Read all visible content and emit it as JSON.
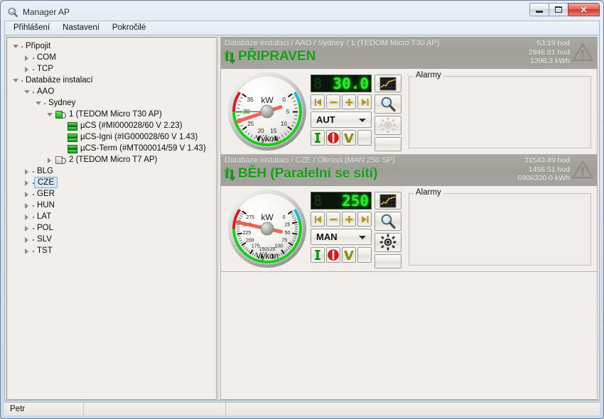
{
  "window": {
    "title": "Manager AP",
    "icon": "app-icon",
    "buttons": {
      "minimize": "minimize",
      "maximize": "restore",
      "close": "✕"
    }
  },
  "menu": {
    "items": [
      {
        "label": "Přihlášení"
      },
      {
        "label": "Nastavení"
      },
      {
        "label": "Pokročilé"
      }
    ]
  },
  "tree": {
    "nodes": [
      {
        "label": "Připojit",
        "depth": 0,
        "state": "open",
        "icon": "none"
      },
      {
        "label": "COM",
        "depth": 1,
        "state": "closed",
        "icon": "none"
      },
      {
        "label": "TCP",
        "depth": 1,
        "state": "closed",
        "icon": "none"
      },
      {
        "label": "Databáze instalací",
        "depth": 0,
        "state": "open",
        "icon": "none"
      },
      {
        "label": "AAO",
        "depth": 1,
        "state": "open",
        "icon": "none"
      },
      {
        "label": "Sydney",
        "depth": 2,
        "state": "open",
        "icon": "none"
      },
      {
        "label": "1 (TEDOM Micro T30 AP)",
        "depth": 3,
        "state": "open",
        "icon": "plug-green"
      },
      {
        "label": "µCS (#MI000028/60  V 2.23)",
        "depth": 4,
        "state": "leaf",
        "icon": "arrows-green"
      },
      {
        "label": "µCS-Igni (#IG000028/60  V 1.43)",
        "depth": 4,
        "state": "leaf",
        "icon": "arrows-green"
      },
      {
        "label": "µCS-Term (#MT000014/59  V 1.43)",
        "depth": 4,
        "state": "leaf",
        "icon": "arrows-green"
      },
      {
        "label": "2 (TEDOM Micro T7 AP)",
        "depth": 3,
        "state": "closed",
        "icon": "plug-grey"
      },
      {
        "label": "BLG",
        "depth": 1,
        "state": "closed",
        "icon": "none"
      },
      {
        "label": "CZE",
        "depth": 1,
        "state": "closed",
        "icon": "none",
        "selected": true
      },
      {
        "label": "GER",
        "depth": 1,
        "state": "closed",
        "icon": "none"
      },
      {
        "label": "HUN",
        "depth": 1,
        "state": "closed",
        "icon": "none"
      },
      {
        "label": "LAT",
        "depth": 1,
        "state": "closed",
        "icon": "none"
      },
      {
        "label": "POL",
        "depth": 1,
        "state": "closed",
        "icon": "none"
      },
      {
        "label": "SLV",
        "depth": 1,
        "state": "closed",
        "icon": "none"
      },
      {
        "label": "TST",
        "depth": 1,
        "state": "closed",
        "icon": "none"
      }
    ]
  },
  "units": [
    {
      "breadcrumb": "Databáze instalací / AAO / Sydney / 1 (TEDOM Micro T30 AP)",
      "state_text": "PŘIPRAVEN",
      "state_color": "#12a012",
      "counters": [
        "53.19 hod",
        "2946.81 hod",
        "1398.3 kWh"
      ],
      "gauge": {
        "title": "Výkon",
        "unit": "kW",
        "min": 0,
        "max": 35,
        "ticks": [
          0,
          5,
          10,
          15,
          20,
          25,
          30,
          35
        ],
        "needle_value": 27.5,
        "setpoint_value": 30.0
      },
      "led_value": "30.0",
      "led_ghost": "8",
      "nav_buttons": [
        "⏮",
        "−",
        "+",
        "⏭"
      ],
      "mode": "AUT",
      "action_buttons": [
        {
          "name": "start",
          "glyph": "I"
        },
        {
          "name": "stop",
          "glyph": "0"
        },
        {
          "name": "confirm",
          "glyph": "✔"
        },
        {
          "name": "blank",
          "glyph": ""
        }
      ],
      "side_buttons": [
        {
          "name": "chart-icon"
        },
        {
          "name": "magnifier-icon"
        },
        {
          "name": "gear-icon",
          "disabled": true
        },
        {
          "name": "blank-button"
        }
      ],
      "alarms_caption": "Alarmy",
      "alarms_items": [],
      "warning_icon": "warning-triangle-icon"
    },
    {
      "breadcrumb": "Databáze instalací / CZE / Olešná (MAN 250 SP)",
      "state_text": "BĚH (Paralelní se sítí)",
      "state_color": "#12a012",
      "counters": [
        "31543.49 hod",
        "1456.51 hod",
        "6906320.0 kWh"
      ],
      "gauge": {
        "title": "Výkon",
        "unit": "kW",
        "min": 0,
        "max": 275,
        "ticks": [
          0,
          25,
          50,
          75,
          100,
          125,
          150,
          175,
          200,
          225,
          250,
          275
        ],
        "needle_value": 250,
        "setpoint_value": 250
      },
      "led_value": "250",
      "led_ghost": "8",
      "nav_buttons": [
        "⏮",
        "−",
        "+",
        "⏭"
      ],
      "mode": "MAN",
      "action_buttons": [
        {
          "name": "start",
          "glyph": "I"
        },
        {
          "name": "stop",
          "glyph": "0"
        },
        {
          "name": "confirm",
          "glyph": "✔"
        },
        {
          "name": "blank",
          "glyph": ""
        }
      ],
      "side_buttons": [
        {
          "name": "chart-icon"
        },
        {
          "name": "magnifier-icon"
        },
        {
          "name": "gear-icon",
          "disabled": false
        },
        {
          "name": "blank-button"
        }
      ],
      "alarms_caption": "Alarmy",
      "alarms_items": [],
      "warning_icon": "warning-triangle-icon"
    }
  ],
  "statusbar": {
    "user": "Petr",
    "cell2": "",
    "cell3": ""
  },
  "colors": {
    "state_green": "#12a012",
    "led_green": "#2cf02c",
    "header_grey": "#a5a49e",
    "selection_blue": "#d6e7f7"
  }
}
